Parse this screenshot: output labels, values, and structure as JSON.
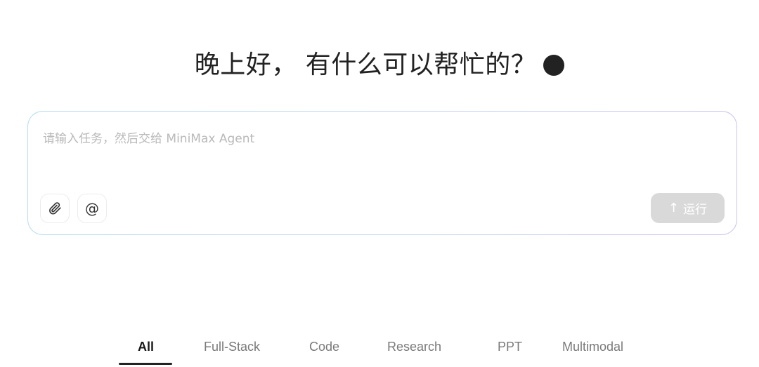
{
  "greeting": {
    "text": "晚上好， 有什么可以帮忙的？"
  },
  "composer": {
    "placeholder": "请输入任务，然后交给 MiniMax Agent",
    "value": "",
    "mention_symbol": "@",
    "run_label": "运行",
    "run_arrow": "↑"
  },
  "icons": {
    "attach": "paperclip-icon",
    "mention": "at-sign-icon",
    "run": "arrow-up-icon"
  },
  "tabs": [
    {
      "label": "All",
      "active": true
    },
    {
      "label": "Full-Stack",
      "active": false
    },
    {
      "label": "Code",
      "active": false
    },
    {
      "label": "Research",
      "active": false
    },
    {
      "label": "PPT",
      "active": false
    },
    {
      "label": "Multimodal",
      "active": false
    }
  ],
  "colors": {
    "text_primary": "#222222",
    "placeholder": "#b9b9b9",
    "run_disabled_bg": "#d9d9d9",
    "border_gradient_start": "#b7dcef",
    "border_gradient_end": "#c9c2ef"
  }
}
